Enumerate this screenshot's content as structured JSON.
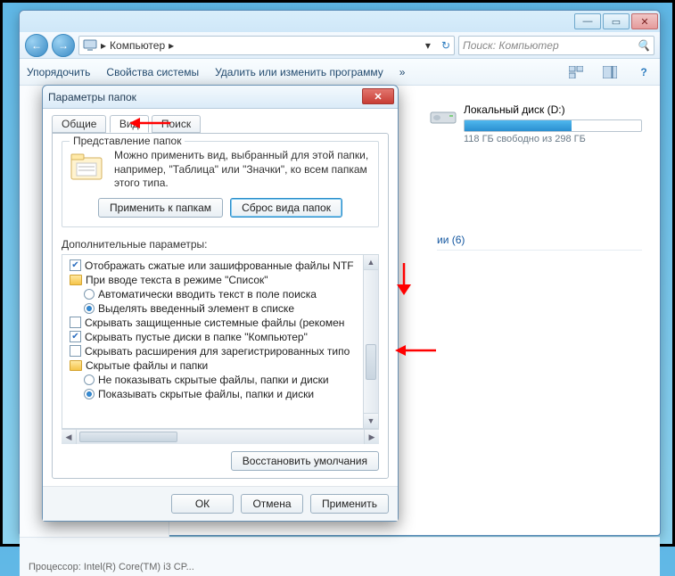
{
  "explorer": {
    "breadcrumb": [
      "Компьютер"
    ],
    "search_placeholder": "Поиск: Компьютер",
    "toolbar": {
      "organize": "Упорядочить",
      "properties": "Свойства системы",
      "uninstall": "Удалить или изменить программу"
    },
    "disk": {
      "label": "Локальный диск (D:)",
      "subtitle": "118 ГБ свободно из 298 ГБ"
    },
    "group_caption": "ии (6)",
    "status_processor": "Процессор: Intel(R) Core(TM) i3 CP..."
  },
  "dialog": {
    "title": "Параметры папок",
    "tabs": {
      "general": "Общие",
      "view": "Вид",
      "search": "Поиск"
    },
    "view_group": {
      "legend": "Представление папок",
      "text": "Можно применить вид, выбранный для этой папки, например, \"Таблица\" или \"Значки\", ко всем папкам этого типа.",
      "apply_btn": "Применить к папкам",
      "reset_btn": "Сброс вида папок"
    },
    "extra_label": "Дополнительные параметры:",
    "tree": [
      {
        "type": "check",
        "checked": true,
        "level": 1,
        "text": "Отображать сжатые или зашифрованные файлы NTF"
      },
      {
        "type": "folder",
        "level": 1,
        "text": "При вводе текста в режиме \"Список\""
      },
      {
        "type": "radio",
        "on": false,
        "level": 2,
        "text": "Автоматически вводить текст в поле поиска"
      },
      {
        "type": "radio",
        "on": true,
        "level": 2,
        "text": "Выделять введенный элемент в списке"
      },
      {
        "type": "check",
        "checked": false,
        "level": 1,
        "text": "Скрывать защищенные системные файлы (рекомен"
      },
      {
        "type": "check",
        "checked": true,
        "level": 1,
        "text": "Скрывать пустые диски в папке \"Компьютер\""
      },
      {
        "type": "check",
        "checked": false,
        "level": 1,
        "text": "Скрывать расширения для зарегистрированных типо"
      },
      {
        "type": "folder",
        "level": 1,
        "text": "Скрытые файлы и папки"
      },
      {
        "type": "radio",
        "on": false,
        "level": 2,
        "text": "Не показывать скрытые файлы, папки и диски"
      },
      {
        "type": "radio",
        "on": true,
        "level": 2,
        "text": "Показывать скрытые файлы, папки и диски"
      }
    ],
    "restore_defaults": "Восстановить умолчания",
    "ok": "ОК",
    "cancel": "Отмена",
    "apply": "Применить"
  }
}
